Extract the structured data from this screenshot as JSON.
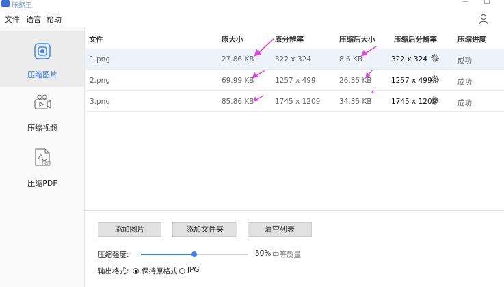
{
  "app": {
    "title": "压缩王"
  },
  "menu": {
    "items": [
      "文件",
      "语言",
      "帮助"
    ]
  },
  "sidebar": {
    "items": [
      {
        "label": "压缩图片",
        "icon": "image-icon",
        "active": true
      },
      {
        "label": "压缩视频",
        "icon": "video-icon",
        "active": false
      },
      {
        "label": "压缩PDF",
        "icon": "pdf-icon",
        "active": false
      }
    ]
  },
  "table": {
    "headers": [
      "文件",
      "原大小",
      "原分辨率",
      "压缩后大小",
      "压缩后分辨率",
      "压缩进度"
    ],
    "rows": [
      {
        "file": "1.png",
        "orig_size": "27.86 KB",
        "orig_res": "322 x 324",
        "new_size": "8.6 KB",
        "new_res": "322 x 324",
        "status": "成功"
      },
      {
        "file": "2.png",
        "orig_size": "69.99 KB",
        "orig_res": "1257 x 499",
        "new_size": "26.35 KB",
        "new_res": "1257 x 499",
        "status": "成功"
      },
      {
        "file": "3.png",
        "orig_size": "85.86 KB",
        "orig_res": "1745 x 1209",
        "new_size": "34.35 KB",
        "new_res": "1745 x 1209",
        "status": "成功"
      }
    ]
  },
  "buttons": {
    "add_images": "添加图片",
    "add_folder": "添加文件夹",
    "clear_list": "清空列表"
  },
  "compression": {
    "label": "压缩强度:",
    "value": 0.5,
    "percent": "50%",
    "quality": "中等质量"
  },
  "output": {
    "label": "输出格式:",
    "options": [
      "保持原格式",
      "JPG"
    ],
    "selected": 0
  },
  "colors": {
    "accent": "#3b82f6",
    "arrow": "#e040e0"
  }
}
